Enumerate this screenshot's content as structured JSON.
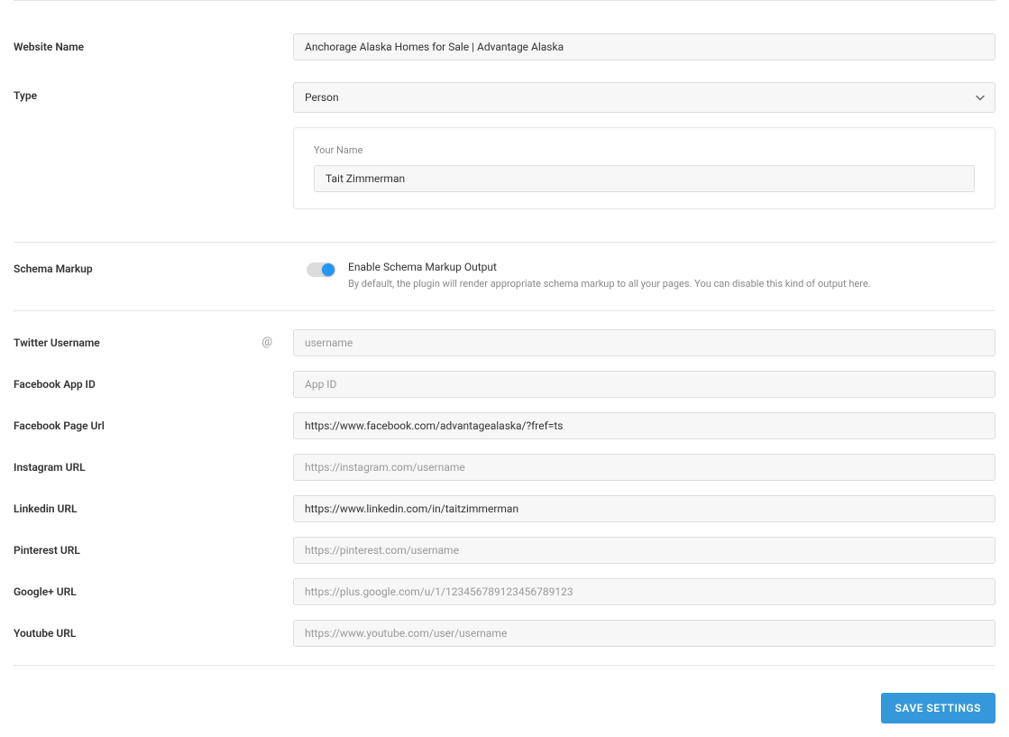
{
  "labels": {
    "websiteName": "Website Name",
    "type": "Type",
    "yourName": "Your Name",
    "schemaMarkup": "Schema Markup",
    "twitterUsername": "Twitter Username",
    "facebookAppId": "Facebook App ID",
    "facebookPageUrl": "Facebook Page Url",
    "instagramUrl": "Instagram URL",
    "linkedinUrl": "Linkedin URL",
    "pinterestUrl": "Pinterest URL",
    "googlePlusUrl": "Google+ URL",
    "youtubeUrl": "Youtube URL",
    "atSymbol": "@"
  },
  "values": {
    "websiteName": "Anchorage Alaska Homes for Sale | Advantage Alaska",
    "type": "Person",
    "yourName": "Tait Zimmerman",
    "twitterUsername": "",
    "facebookAppId": "",
    "facebookPageUrl": "https://www.facebook.com/advantagealaska/?fref=ts",
    "instagramUrl": "",
    "linkedinUrl": "https://www.linkedin.com/in/taitzimmerman",
    "pinterestUrl": "",
    "googlePlusUrl": "",
    "youtubeUrl": ""
  },
  "placeholders": {
    "twitterUsername": "username",
    "facebookAppId": "App ID",
    "instagramUrl": "https://instagram.com/username",
    "pinterestUrl": "https://pinterest.com/username",
    "googlePlusUrl": "https://plus.google.com/u/1/123456789123456789123",
    "youtubeUrl": "https://www.youtube.com/user/username"
  },
  "schemaToggle": {
    "on": true,
    "title": "Enable Schema Markup Output",
    "description": "By default, the plugin will render appropriate schema markup to all your pages. You can disable this kind of output here."
  },
  "buttons": {
    "save": "SAVE SETTINGS"
  }
}
